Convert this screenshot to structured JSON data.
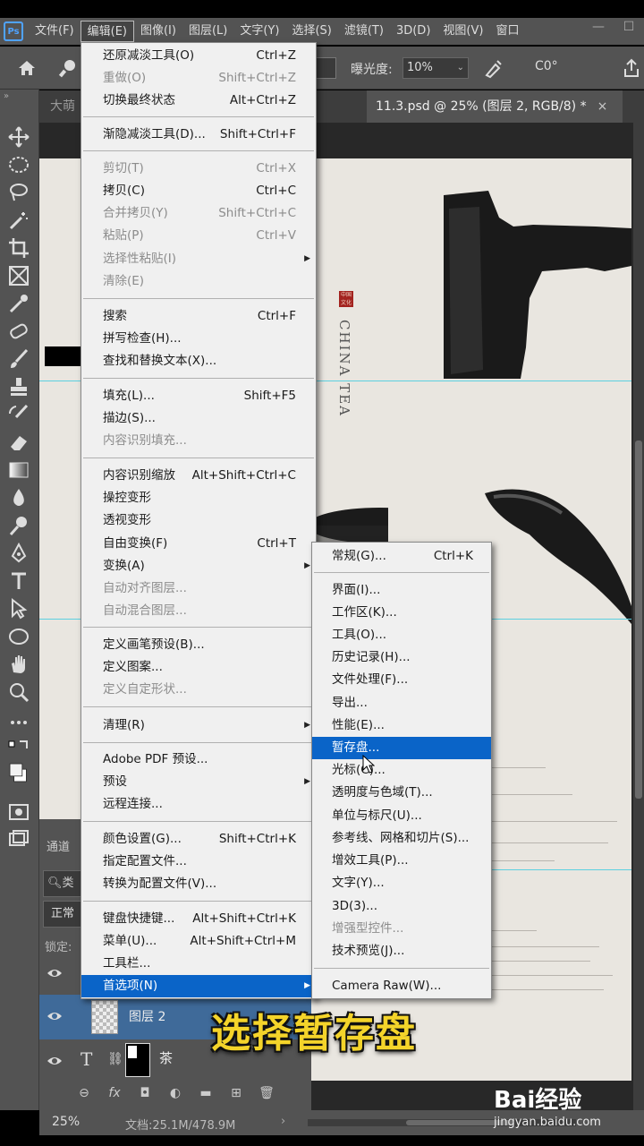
{
  "app": {
    "logo": "Ps"
  },
  "menubar": {
    "items": [
      "文件(F)",
      "编辑(E)",
      "图像(I)",
      "图层(L)",
      "文字(Y)",
      "选择(S)",
      "滤镜(T)",
      "3D(D)",
      "视图(V)",
      "窗口"
    ],
    "active": "编辑(E)"
  },
  "options": {
    "exposure_label": "曝光度:",
    "exposure_value": "10%",
    "angle_value": "C0°"
  },
  "tabs": {
    "tab1": "大萌",
    "tab2": "11.3.psd @ 25% (图层 2, RGB/8) *",
    "tab2_close": "×"
  },
  "edit_menu": {
    "items": [
      {
        "label": "还原减淡工具(O)",
        "shortcut": "Ctrl+Z",
        "disabled": false
      },
      {
        "label": "重做(O)",
        "shortcut": "Shift+Ctrl+Z",
        "disabled": true
      },
      {
        "label": "切换最终状态",
        "shortcut": "Alt+Ctrl+Z",
        "disabled": false
      },
      {
        "label": "渐隐减淡工具(D)...",
        "shortcut": "Shift+Ctrl+F",
        "disabled": false
      },
      {
        "label": "剪切(T)",
        "shortcut": "Ctrl+X",
        "disabled": true
      },
      {
        "label": "拷贝(C)",
        "shortcut": "Ctrl+C",
        "disabled": false
      },
      {
        "label": "合并拷贝(Y)",
        "shortcut": "Shift+Ctrl+C",
        "disabled": true
      },
      {
        "label": "粘贴(P)",
        "shortcut": "Ctrl+V",
        "disabled": true
      },
      {
        "label": "选择性粘贴(I)",
        "shortcut": "",
        "disabled": true
      },
      {
        "label": "清除(E)",
        "shortcut": "",
        "disabled": true
      },
      {
        "label": "搜索",
        "shortcut": "Ctrl+F",
        "disabled": false
      },
      {
        "label": "拼写检查(H)...",
        "shortcut": "",
        "disabled": false
      },
      {
        "label": "查找和替换文本(X)...",
        "shortcut": "",
        "disabled": false
      },
      {
        "label": "填充(L)...",
        "shortcut": "Shift+F5",
        "disabled": false
      },
      {
        "label": "描边(S)...",
        "shortcut": "",
        "disabled": false
      },
      {
        "label": "内容识别填充...",
        "shortcut": "",
        "disabled": true
      },
      {
        "label": "内容识别缩放",
        "shortcut": "Alt+Shift+Ctrl+C",
        "disabled": false
      },
      {
        "label": "操控变形",
        "shortcut": "",
        "disabled": false
      },
      {
        "label": "透视变形",
        "shortcut": "",
        "disabled": false
      },
      {
        "label": "自由变换(F)",
        "shortcut": "Ctrl+T",
        "disabled": false
      },
      {
        "label": "变换(A)",
        "shortcut": "",
        "disabled": false
      },
      {
        "label": "自动对齐图层...",
        "shortcut": "",
        "disabled": true
      },
      {
        "label": "自动混合图层...",
        "shortcut": "",
        "disabled": true
      },
      {
        "label": "定义画笔预设(B)...",
        "shortcut": "",
        "disabled": false
      },
      {
        "label": "定义图案...",
        "shortcut": "",
        "disabled": false
      },
      {
        "label": "定义自定形状...",
        "shortcut": "",
        "disabled": true
      },
      {
        "label": "清理(R)",
        "shortcut": "",
        "disabled": false
      },
      {
        "label": "Adobe PDF 预设...",
        "shortcut": "",
        "disabled": false
      },
      {
        "label": "预设",
        "shortcut": "",
        "disabled": false
      },
      {
        "label": "远程连接...",
        "shortcut": "",
        "disabled": false
      },
      {
        "label": "颜色设置(G)...",
        "shortcut": "Shift+Ctrl+K",
        "disabled": false
      },
      {
        "label": "指定配置文件...",
        "shortcut": "",
        "disabled": false
      },
      {
        "label": "转换为配置文件(V)...",
        "shortcut": "",
        "disabled": false
      },
      {
        "label": "键盘快捷键...",
        "shortcut": "Alt+Shift+Ctrl+K",
        "disabled": false
      },
      {
        "label": "菜单(U)...",
        "shortcut": "Alt+Shift+Ctrl+M",
        "disabled": false
      },
      {
        "label": "工具栏...",
        "shortcut": "",
        "disabled": false
      },
      {
        "label": "首选项(N)",
        "shortcut": "",
        "disabled": false
      }
    ]
  },
  "pref_menu": {
    "items": [
      {
        "label": "常规(G)...",
        "shortcut": "Ctrl+K"
      },
      {
        "label": "界面(I)...",
        "shortcut": ""
      },
      {
        "label": "工作区(K)...",
        "shortcut": ""
      },
      {
        "label": "工具(O)...",
        "shortcut": ""
      },
      {
        "label": "历史记录(H)...",
        "shortcut": ""
      },
      {
        "label": "文件处理(F)...",
        "shortcut": ""
      },
      {
        "label": "导出...",
        "shortcut": ""
      },
      {
        "label": "性能(E)...",
        "shortcut": ""
      },
      {
        "label": "暂存盘...",
        "shortcut": ""
      },
      {
        "label": "光标(C)...",
        "shortcut": ""
      },
      {
        "label": "透明度与色域(T)...",
        "shortcut": ""
      },
      {
        "label": "单位与标尺(U)...",
        "shortcut": ""
      },
      {
        "label": "参考线、网格和切片(S)...",
        "shortcut": ""
      },
      {
        "label": "增效工具(P)...",
        "shortcut": ""
      },
      {
        "label": "文字(Y)...",
        "shortcut": ""
      },
      {
        "label": "3D(3)...",
        "shortcut": ""
      },
      {
        "label": "增强型控件...",
        "shortcut": "",
        "disabled": true
      },
      {
        "label": "技术预览(J)...",
        "shortcut": ""
      },
      {
        "label": "Camera Raw(W)...",
        "shortcut": ""
      }
    ]
  },
  "canvas": {
    "seal": "中国文化",
    "vertical_text": "CHINA TEA"
  },
  "layers_panel": {
    "tab": "通道",
    "search": "类",
    "blend_mode": "正常",
    "lock_label": "锁定:",
    "layer2_name": "图层 2",
    "text_layer_name": "茶"
  },
  "status": {
    "zoom": "25%",
    "doc": "文档:25.1M/478.9M",
    "arrow": "›"
  },
  "caption": "选择暂存盘",
  "watermark": {
    "brand": "Bai经验",
    "url": "jingyan.baidu.com"
  },
  "colors": {
    "highlight": "#0a64c8",
    "caption": "#f4d42a",
    "guide": "#5cd0e0",
    "layer_selected": "#3f6a99"
  }
}
